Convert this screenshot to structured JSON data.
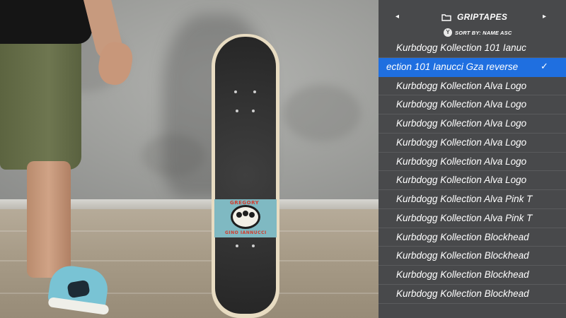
{
  "panel": {
    "category_title": "GRIPTAPES",
    "prev_arrow": "◂",
    "next_arrow": "▸",
    "sort_button_glyph": "Y",
    "sort_label": "SORT BY: NAME ASC",
    "selected_color": "#1f6fe0",
    "background_color": "#48494b",
    "items": [
      {
        "label": "Kurbdogg Kollection 101 Ianuc",
        "selected": false
      },
      {
        "label": "ection 101 Ianucci Gza reverse",
        "selected": true
      },
      {
        "label": "Kurbdogg Kollection Alva Logo",
        "selected": false
      },
      {
        "label": "Kurbdogg Kollection Alva Logo",
        "selected": false
      },
      {
        "label": "Kurbdogg Kollection Alva Logo",
        "selected": false
      },
      {
        "label": "Kurbdogg Kollection Alva Logo",
        "selected": false
      },
      {
        "label": "Kurbdogg Kollection Alva Logo",
        "selected": false
      },
      {
        "label": "Kurbdogg Kollection Alva Logo",
        "selected": false
      },
      {
        "label": "Kurbdogg Kollection Alva Pink T",
        "selected": false
      },
      {
        "label": "Kurbdogg Kollection Alva Pink T",
        "selected": false
      },
      {
        "label": "Kurbdogg Kollection Blockhead",
        "selected": false
      },
      {
        "label": "Kurbdogg Kollection Blockhead",
        "selected": false
      },
      {
        "label": "Kurbdogg Kollection Blockhead",
        "selected": false
      },
      {
        "label": "Kurbdogg Kollection Blockhead",
        "selected": false
      }
    ],
    "check_glyph": "✓"
  },
  "scene": {
    "sticker_top_text": "GREGORY",
    "sticker_bottom_text": "GINO IANNUCCI"
  }
}
